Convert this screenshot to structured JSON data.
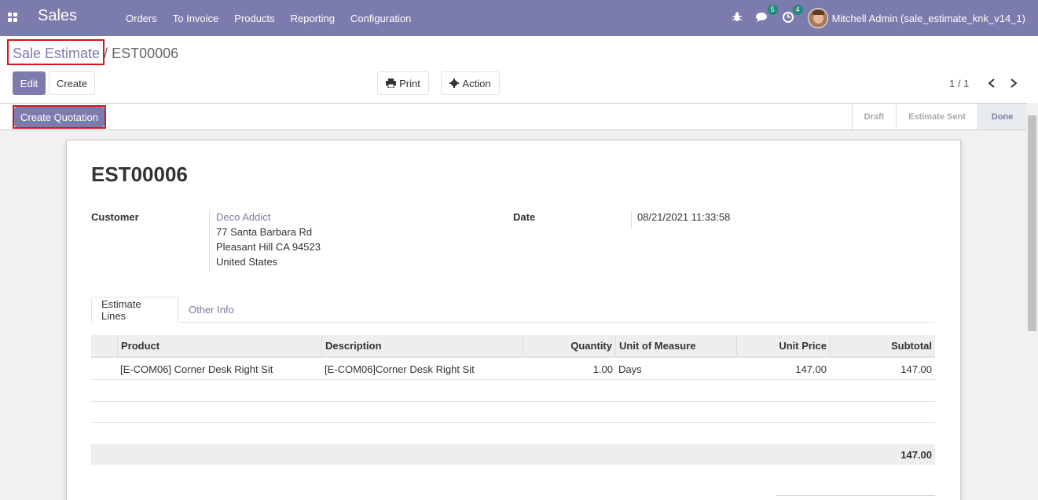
{
  "navbar": {
    "brand": "Sales",
    "menu": [
      "Orders",
      "To Invoice",
      "Products",
      "Reporting",
      "Configuration"
    ],
    "messages_count": "5",
    "activities_count": "4",
    "user": "Mitchell Admin (sale_estimate_knk_v14_1)"
  },
  "breadcrumb": {
    "parent": "Sale Estimate",
    "separator": "/",
    "current": "EST00006"
  },
  "buttons": {
    "edit": "Edit",
    "create": "Create",
    "print": "Print",
    "action": "Action",
    "create_quotation": "Create Quotation"
  },
  "pager": {
    "value": "1 / 1"
  },
  "status": {
    "stages": [
      "Draft",
      "Estimate Sent",
      "Done"
    ],
    "active": "Done"
  },
  "record": {
    "name": "EST00006",
    "customer_label": "Customer",
    "customer_name": "Deco Addict",
    "address_line1": "77 Santa Barbara Rd",
    "address_line2": "Pleasant Hill CA 94523",
    "address_line3": "United States",
    "date_label": "Date",
    "date_value": "08/21/2021 11:33:58"
  },
  "tabs": [
    "Estimate Lines",
    "Other Info"
  ],
  "table": {
    "headers": [
      "Product",
      "Description",
      "Quantity",
      "Unit of Measure",
      "Unit Price",
      "Subtotal"
    ],
    "rows": [
      [
        "[E-COM06] Corner Desk Right Sit",
        "[E-COM06]Corner Desk Right Sit",
        "1.00",
        "Days",
        "147.00",
        "147.00"
      ]
    ],
    "total": "147.00"
  }
}
